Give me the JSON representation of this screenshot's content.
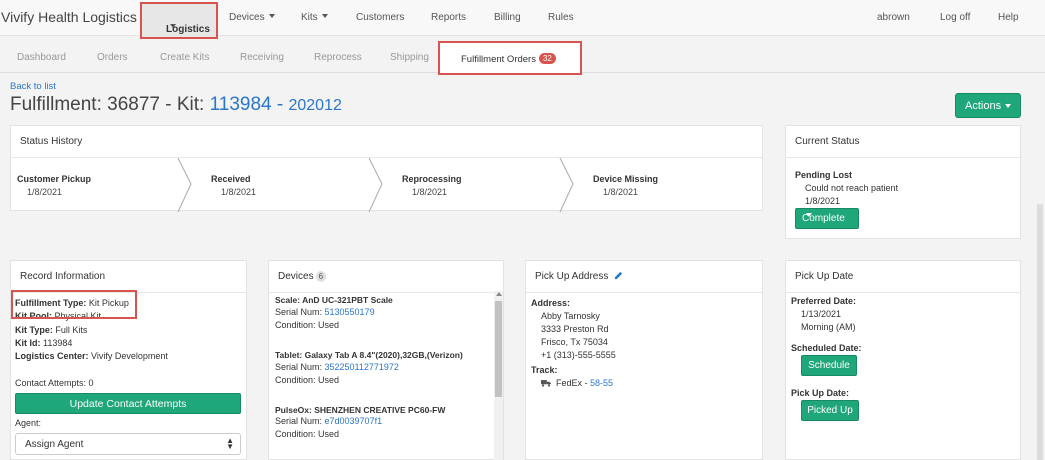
{
  "topnav": {
    "brand": "Vivify Health Logistics",
    "items": [
      "Logistics",
      "Devices",
      "Kits",
      "Customers",
      "Reports",
      "Billing",
      "Rules"
    ],
    "user": "abrown",
    "logoff": "Log off",
    "help": "Help"
  },
  "subnav": {
    "items": [
      "Dashboard",
      "Orders",
      "Create Kits",
      "Receiving",
      "Reprocess",
      "Shipping",
      "Fulfillment Orders"
    ],
    "badge": "32"
  },
  "page": {
    "back": "Back to list",
    "title_prefix": "Fulfillment: 36877 - Kit: ",
    "kit_id": "113984",
    "dash": " - ",
    "sub_id": "202012",
    "actions": "Actions"
  },
  "status_history": {
    "title": "Status History",
    "steps": [
      {
        "name": "Customer Pickup",
        "date": "1/8/2021"
      },
      {
        "name": "Received",
        "date": "1/8/2021"
      },
      {
        "name": "Reprocessing",
        "date": "1/8/2021"
      },
      {
        "name": "Device Missing",
        "date": "1/8/2021"
      }
    ]
  },
  "current_status": {
    "title": "Current Status",
    "status": "Pending Lost",
    "reason": "Could not reach patient",
    "date": "1/8/2021",
    "button": "Complete"
  },
  "record": {
    "title": "Record Information",
    "fulfillment_type_label": "Fulfillment Type:",
    "fulfillment_type": "Kit Pickup",
    "kit_pool_label": "Kit Pool:",
    "kit_pool": "Physical Kit",
    "kit_type_label": "Kit Type:",
    "kit_type": "Full Kits",
    "kit_id_label": "Kit Id:",
    "kit_id": "113984",
    "logistics_label": "Logistics Center:",
    "logistics": "Vivify Development",
    "contact_attempts": "Contact Attempts: 0",
    "update_button": "Update Contact Attempts",
    "agent_label": "Agent:",
    "agent_value": "Assign Agent"
  },
  "devices": {
    "title": "Devices",
    "count": "6",
    "items": [
      {
        "name": "Scale: AnD UC-321PBT Scale",
        "serial_label": "Serial Num: ",
        "serial": "5130550179",
        "condition": "Condition: Used"
      },
      {
        "name": "Tablet: Galaxy Tab A 8.4\"(2020),32GB,(Verizon)",
        "serial_label": "Serial Num: ",
        "serial": "352250112771972",
        "condition": "Condition: Used"
      },
      {
        "name": "PulseOx: SHENZHEN CREATIVE PC60-FW",
        "serial_label": "Serial Num: ",
        "serial": "e7d0039707f1",
        "condition": "Condition: Used"
      }
    ]
  },
  "pickup_address": {
    "title": "Pick Up Address",
    "address_label": "Address:",
    "lines": [
      "Abby Tarnosky",
      "3333 Preston Rd",
      "Frisco, Tx 75034",
      "+1 (313)-555-5555"
    ],
    "track_label": "Track:",
    "carrier": "FedEx - ",
    "tracking": "58-55"
  },
  "pickup_date": {
    "title": "Pick Up Date",
    "preferred_label": "Preferred Date:",
    "preferred_date": "1/13/2021",
    "preferred_time": "Morning (AM)",
    "scheduled_label": "Scheduled Date:",
    "schedule_button": "Schedule",
    "pickup_label": "Pick Up Date:",
    "picked_up_button": "Picked Up"
  }
}
